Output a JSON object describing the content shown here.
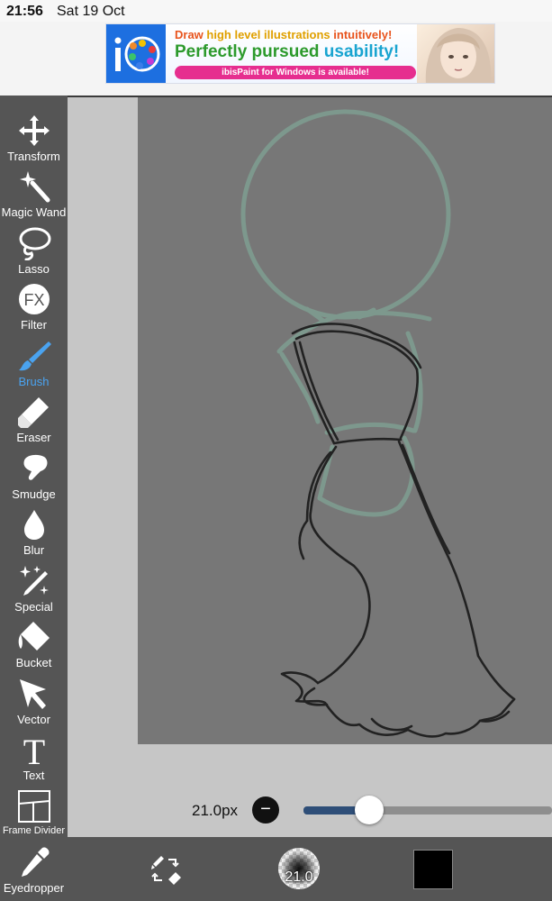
{
  "status_bar": {
    "time": "21:56",
    "date": "Sat 19 Oct"
  },
  "ad": {
    "line1_a": "Draw ",
    "line1_b": "high level illustrations",
    "line1_c": " intuitively!",
    "line2_a": "Perfectly pursued ",
    "line2_b": "usability!",
    "pill": "ibisPaint for Windows is available!",
    "logo_icon": "ibispaint-logo-icon"
  },
  "tools": [
    {
      "label": "Transform",
      "icon": "move-arrows-icon"
    },
    {
      "label": "Magic Wand",
      "icon": "magic-wand-icon"
    },
    {
      "label": "Lasso",
      "icon": "lasso-icon"
    },
    {
      "label": "Filter",
      "icon": "fx-icon"
    },
    {
      "label": "Brush",
      "icon": "brush-icon",
      "active": true
    },
    {
      "label": "Eraser",
      "icon": "eraser-icon"
    },
    {
      "label": "Smudge",
      "icon": "smudge-finger-icon"
    },
    {
      "label": "Blur",
      "icon": "drop-icon"
    },
    {
      "label": "Special",
      "icon": "sparkle-pen-icon"
    },
    {
      "label": "Bucket",
      "icon": "bucket-icon"
    },
    {
      "label": "Vector",
      "icon": "cursor-arrow-icon"
    },
    {
      "label": "Text",
      "icon": "text-t-icon"
    },
    {
      "label": "Frame Divider",
      "icon": "frame-divider-icon"
    },
    {
      "label": "Eyedropper",
      "icon": "eyedropper-icon"
    }
  ],
  "brush_size": {
    "label": "21.0px",
    "minus": "−",
    "slider_fraction": 0.27
  },
  "bottom": {
    "brush_preview_label": "21.0",
    "current_color": "#000000"
  },
  "colors": {
    "accent": "#4aa3f0",
    "toolbar_bg": "#555555",
    "canvas_bg": "#777777",
    "guide_stroke": "#7d988d"
  }
}
